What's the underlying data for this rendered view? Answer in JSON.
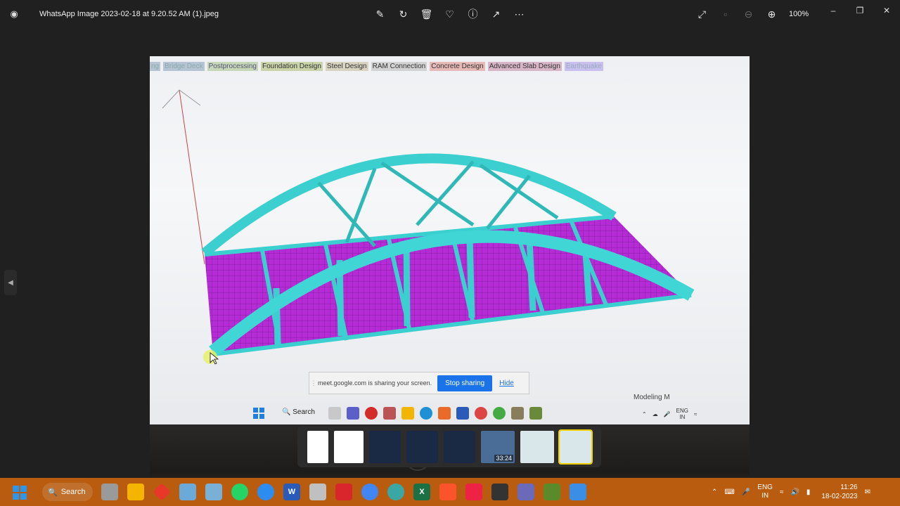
{
  "titlebar": {
    "file_name": "WhatsApp Image 2023-02-18 at 9.20.52 AM (1).jpeg",
    "zoom": "100%",
    "toolbar_icons": [
      "edit-icon",
      "rotate-icon",
      "delete-icon",
      "favorite-icon",
      "info-icon",
      "share-icon",
      "more-icon"
    ],
    "right_icons": [
      "fullscreen-icon",
      "fit-icon",
      "zoom-out-icon",
      "zoom-in-icon"
    ]
  },
  "photo": {
    "menu_tabs": [
      "ng",
      "Bridge Deck",
      "Postprocessing",
      "Foundation Design",
      "Steel Design",
      "RAM Connection",
      "Concrete Design",
      "Advanced Slab Design",
      "Earthquake"
    ],
    "share_bar": {
      "message": "meet.google.com is sharing your screen.",
      "stop_label": "Stop sharing",
      "hide_label": "Hide"
    },
    "status_text": "Modeling M",
    "laptop_taskbar": {
      "search_label": "Search",
      "lang_top": "ENG",
      "lang_bottom": "IN"
    },
    "brand": "hp"
  },
  "filmstrip": {
    "thumb_time": "33:24"
  },
  "taskbar": {
    "search_label": "Search",
    "lang_top": "ENG",
    "lang_bottom": "IN",
    "time": "11:26",
    "date": "18-02-2023"
  },
  "colors": {
    "bridge_cyan": "#3ccfcf",
    "deck_magenta": "#b52bd6",
    "taskbar_orange": "#b95c0f"
  }
}
